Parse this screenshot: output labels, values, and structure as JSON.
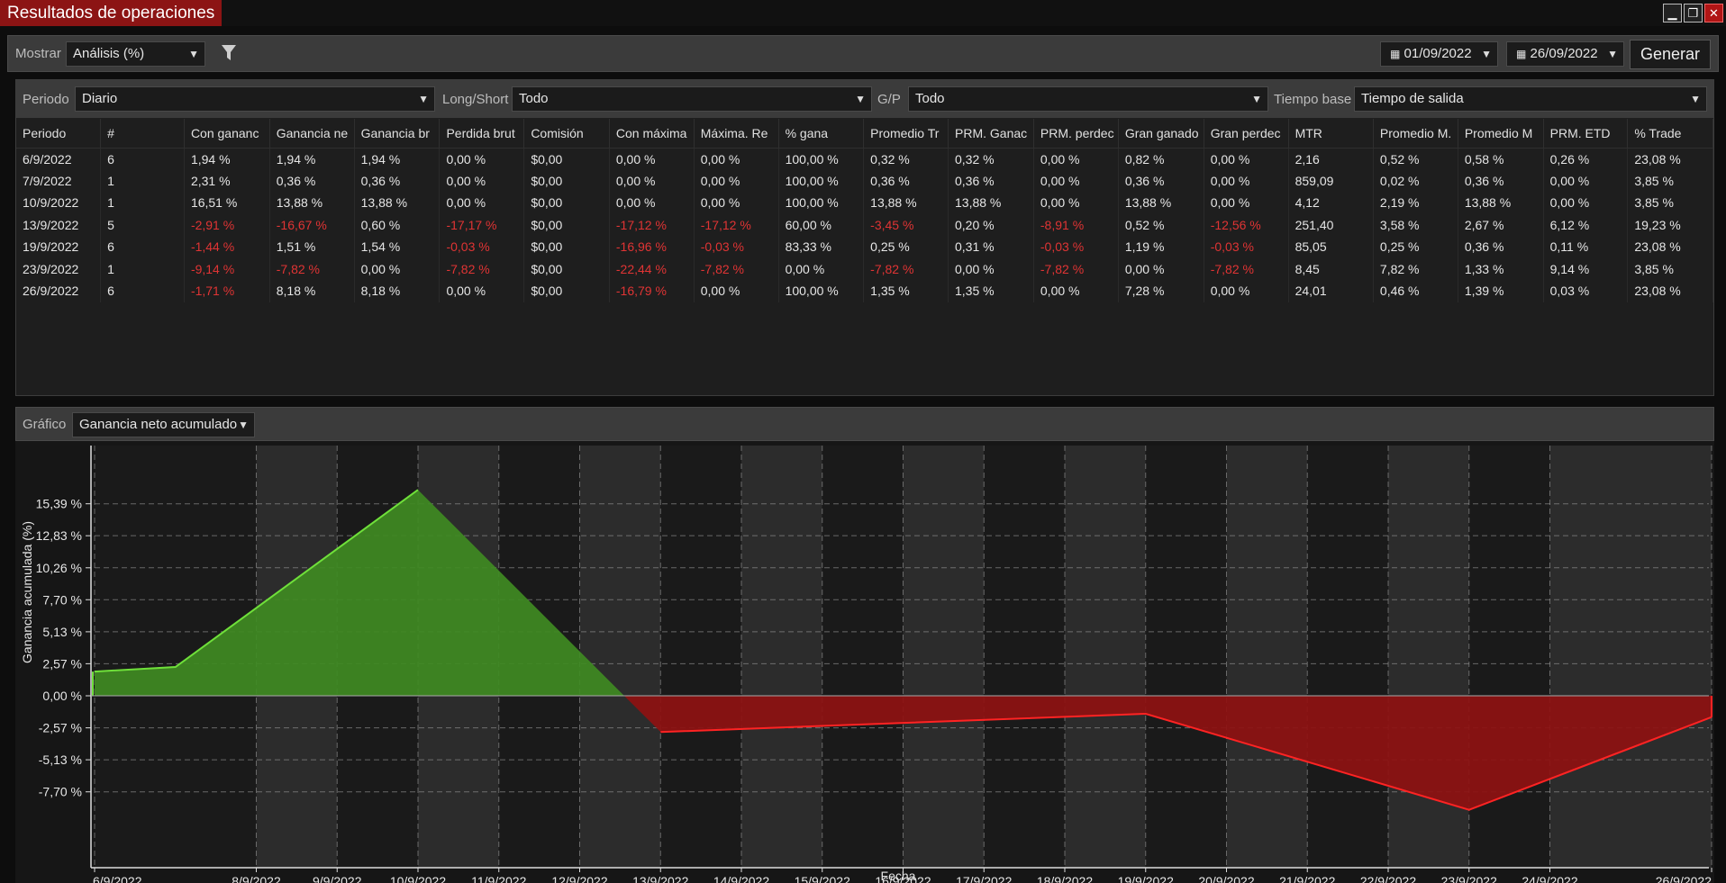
{
  "window": {
    "title": "Resultados de operaciones",
    "controls": {
      "minimize": "▁",
      "restore": "❐",
      "close": "✕"
    }
  },
  "toolbar": {
    "show_label": "Mostrar",
    "show_value": "Análisis (%)",
    "date_from": "01/09/2022",
    "date_to": "26/09/2022",
    "generate_label": "Generar"
  },
  "filters": {
    "period_label": "Periodo",
    "period_value": "Diario",
    "longshort_label": "Long/Short",
    "longshort_value": "Todo",
    "gp_label": "G/P",
    "gp_value": "Todo",
    "timebase_label": "Tiempo base",
    "timebase_value": "Tiempo de salida"
  },
  "table": {
    "columns": [
      "Periodo",
      "#",
      "Con gananc",
      "Ganancia ne",
      "Ganancia br",
      "Perdida brut",
      "Comisión",
      "Con máxima",
      "Máxima. Re",
      "% gana",
      "Promedio Tr",
      "PRM. Ganac",
      "PRM. perdec",
      "Gran ganado",
      "Gran perdec",
      "MTR",
      "Promedio M.",
      "Promedio M",
      "PRM. ETD",
      "% Trade"
    ],
    "rows": [
      [
        "6/9/2022",
        "6",
        "1,94 %",
        "1,94 %",
        "1,94 %",
        "0,00 %",
        "$0,00",
        "0,00 %",
        "0,00 %",
        "100,00 %",
        "0,32 %",
        "0,32 %",
        "0,00 %",
        "0,82 %",
        "0,00 %",
        "2,16",
        "0,52 %",
        "0,58 %",
        "0,26 %",
        "23,08 %"
      ],
      [
        "7/9/2022",
        "1",
        "2,31 %",
        "0,36 %",
        "0,36 %",
        "0,00 %",
        "$0,00",
        "0,00 %",
        "0,00 %",
        "100,00 %",
        "0,36 %",
        "0,36 %",
        "0,00 %",
        "0,36 %",
        "0,00 %",
        "859,09",
        "0,02 %",
        "0,36 %",
        "0,00 %",
        "3,85 %"
      ],
      [
        "10/9/2022",
        "1",
        "16,51 %",
        "13,88 %",
        "13,88 %",
        "0,00 %",
        "$0,00",
        "0,00 %",
        "0,00 %",
        "100,00 %",
        "13,88 %",
        "13,88 %",
        "0,00 %",
        "13,88 %",
        "0,00 %",
        "4,12",
        "2,19 %",
        "13,88 %",
        "0,00 %",
        "3,85 %"
      ],
      [
        "13/9/2022",
        "5",
        "-2,91 %",
        "-16,67 %",
        "0,60 %",
        "-17,17 %",
        "$0,00",
        "-17,12 %",
        "-17,12 %",
        "60,00 %",
        "-3,45 %",
        "0,20 %",
        "-8,91 %",
        "0,52 %",
        "-12,56 %",
        "251,40",
        "3,58 %",
        "2,67 %",
        "6,12 %",
        "19,23 %"
      ],
      [
        "19/9/2022",
        "6",
        "-1,44 %",
        "1,51 %",
        "1,54 %",
        "-0,03 %",
        "$0,00",
        "-16,96 %",
        "-0,03 %",
        "83,33 %",
        "0,25 %",
        "0,31 %",
        "-0,03 %",
        "1,19 %",
        "-0,03 %",
        "85,05",
        "0,25 %",
        "0,36 %",
        "0,11 %",
        "23,08 %"
      ],
      [
        "23/9/2022",
        "1",
        "-9,14 %",
        "-7,82 %",
        "0,00 %",
        "-7,82 %",
        "$0,00",
        "-22,44 %",
        "-7,82 %",
        "0,00 %",
        "-7,82 %",
        "0,00 %",
        "-7,82 %",
        "0,00 %",
        "-7,82 %",
        "8,45",
        "7,82 %",
        "1,33 %",
        "9,14 %",
        "3,85 %"
      ],
      [
        "26/9/2022",
        "6",
        "-1,71 %",
        "8,18 %",
        "8,18 %",
        "0,00 %",
        "$0,00",
        "-16,79 %",
        "0,00 %",
        "100,00 %",
        "1,35 %",
        "1,35 %",
        "0,00 %",
        "7,28 %",
        "0,00 %",
        "24,01",
        "0,46 %",
        "1,39 %",
        "0,03 %",
        "23,08 %"
      ]
    ]
  },
  "chart_panel": {
    "label": "Gráfico",
    "value": "Ganancia neto acumulado"
  },
  "colors": {
    "positive_fill": "#3f8a22",
    "positive_line": "#6fe03a",
    "negative_fill": "#8e1111",
    "negative_line": "#ff2323",
    "negative_text": "#e03434",
    "title_red": "#8c1414"
  },
  "icons": {
    "filter": "filter-icon",
    "calendar": "calendar-icon",
    "chevron": "chevron-down-icon"
  },
  "chart_data": {
    "type": "area",
    "xlabel": "Fecha",
    "ylabel": "Ganancia acumulada (%)",
    "yticks": [
      "15,39 %",
      "12,83 %",
      "10,26 %",
      "7,70 %",
      "5,13 %",
      "2,57 %",
      "0,00 %",
      "-2,57 %",
      "-5,13 %",
      "-7,70 %"
    ],
    "ylim": [
      -9.2,
      16.6
    ],
    "xticks": [
      "6/9/2022",
      "8/9/2022",
      "9/9/2022",
      "10/9/2022",
      "11/9/2022",
      "12/9/2022",
      "13/9/2022",
      "14/9/2022",
      "15/9/2022",
      "16/9/2022",
      "17/9/2022",
      "18/9/2022",
      "19/9/2022",
      "20/9/2022",
      "21/9/2022",
      "22/9/2022",
      "23/9/2022",
      "24/9/2022",
      "26/9/2022"
    ],
    "x": [
      "6/9/2022",
      "7/9/2022",
      "10/9/2022",
      "13/9/2022",
      "19/9/2022",
      "23/9/2022",
      "26/9/2022"
    ],
    "x_index": [
      0,
      1,
      4,
      7,
      13,
      17,
      20
    ],
    "values": [
      1.94,
      2.31,
      16.51,
      -2.91,
      -1.44,
      -9.14,
      -1.71
    ],
    "grid": true
  }
}
